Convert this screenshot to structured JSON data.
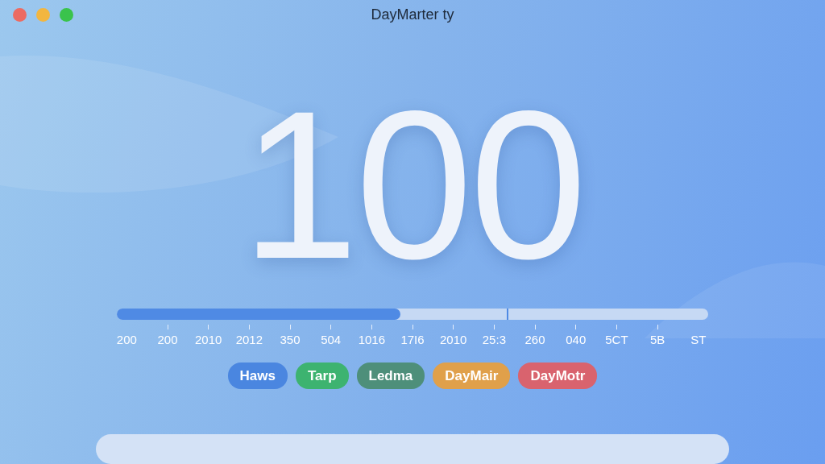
{
  "window": {
    "title": "DayMarter ty"
  },
  "counter": {
    "value": "100"
  },
  "timeline": {
    "level": 0.48,
    "cursor": {
      "level": 0.66
    },
    "labels": [
      "200",
      "200",
      "2010",
      "2012",
      "350",
      "504",
      "1016",
      "17I6",
      "2010",
      "25:3",
      "260",
      "040",
      "5CT",
      "5B",
      "ST"
    ]
  },
  "tags": [
    {
      "label": "Haws",
      "color": "#4a86e0"
    },
    {
      "label": "Tarp",
      "color": "#3db370"
    },
    {
      "label": "Ledma",
      "color": "#4e8f7a"
    },
    {
      "label": "DayMair",
      "color": "#e0a04a"
    },
    {
      "label": "DayMotr",
      "color": "#d9636e"
    }
  ]
}
